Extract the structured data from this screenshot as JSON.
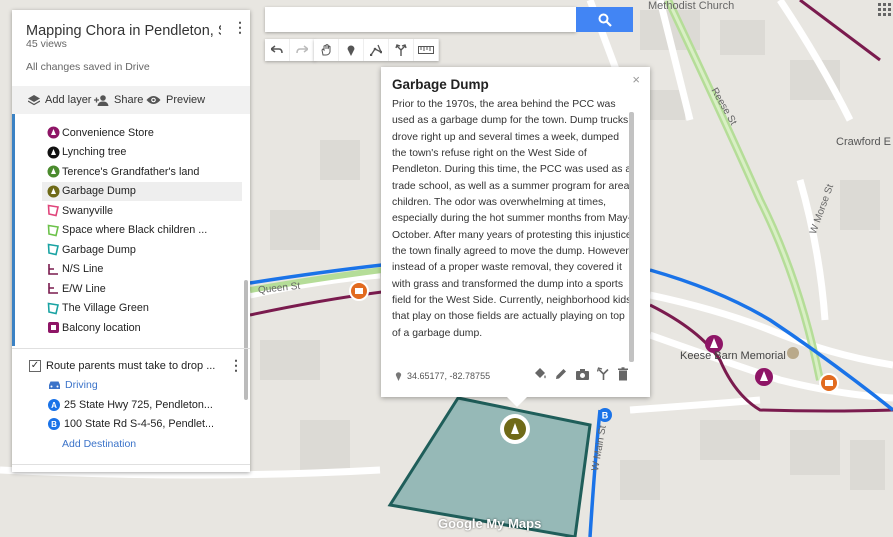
{
  "panel": {
    "title": "Mapping Chora in Pendleton, Sou...",
    "views": "45 views",
    "saved": "All changes saved in Drive",
    "add_layer": "Add layer",
    "share": "Share",
    "preview": "Preview"
  },
  "layer_items": [
    {
      "label": "Convenience Store",
      "icon": "store-icon",
      "color": "#8e1566"
    },
    {
      "label": "Lynching tree",
      "icon": "tree-icon",
      "color": "#111111"
    },
    {
      "label": "Terence's Grandfather's land",
      "icon": "house-icon",
      "color": "#4b8b2e"
    },
    {
      "label": "Garbage Dump",
      "icon": "bell-icon",
      "color": "#6f6a18"
    },
    {
      "label": "Swanyville",
      "icon": "polygon-icon",
      "color": "#e0457b"
    },
    {
      "label": "Space where Black children ...",
      "icon": "polygon-icon",
      "color": "#6cc24a"
    },
    {
      "label": "Garbage Dump",
      "icon": "polygon-icon",
      "color": "#1aa3a3"
    },
    {
      "label": "N/S Line",
      "icon": "line-icon",
      "color": "#7a1b4e"
    },
    {
      "label": "E/W Line",
      "icon": "line-icon",
      "color": "#7a1b4e"
    },
    {
      "label": "The Village Green",
      "icon": "polygon-icon",
      "color": "#1aa3a3"
    },
    {
      "label": "Balcony location",
      "icon": "square-icon",
      "color": "#8e1566"
    }
  ],
  "route": {
    "title": "Route parents must take to drop ...",
    "mode": "Driving",
    "stop_a_letter": "A",
    "stop_a": "25 State Hwy 725, Pendleton...",
    "stop_b_letter": "B",
    "stop_b": "100 State Rd S-4-56, Pendlet...",
    "add_destination": "Add Destination"
  },
  "popup": {
    "title": "Garbage Dump",
    "description": "Prior to the 1970s, the area behind the PCC was used as a garbage dump for the town. Dump trucks drove right up and several times a week, dumped the town's refuse right on the West Side of Pendleton. During this time, the PCC was used as a trade school, as well as a summer program for area children. The odor was overwhelming at times, especially during the hot summer months from May-October. After many years of protesting this injustice, the town finally agreed to move the dump. However, instead of a proper waste removal, they covered it with grass and transformed the dump into a sports field for the West Side. Currently, neighborhood kids that play on those fields are actually playing on top of a garbage dump.",
    "coords": "34.65177, -82.78755",
    "close": "×"
  },
  "map_labels": {
    "church": "Methodist Church",
    "crawford": "Crawford E",
    "morse": "W Morse St",
    "reese": "Reese St",
    "queen": "Queen St",
    "keese_barn": "Keese Barn Memorial",
    "w_main": "W Main St",
    "marker_b": "B",
    "logo_google": "Google",
    "logo_mymaps": "My Maps"
  },
  "colors": {
    "route_blue": "#1a73e8",
    "line_maroon": "#7a1b4e",
    "dump_fill": "#7ba9a8",
    "dump_stroke": "#1f5e5a"
  }
}
